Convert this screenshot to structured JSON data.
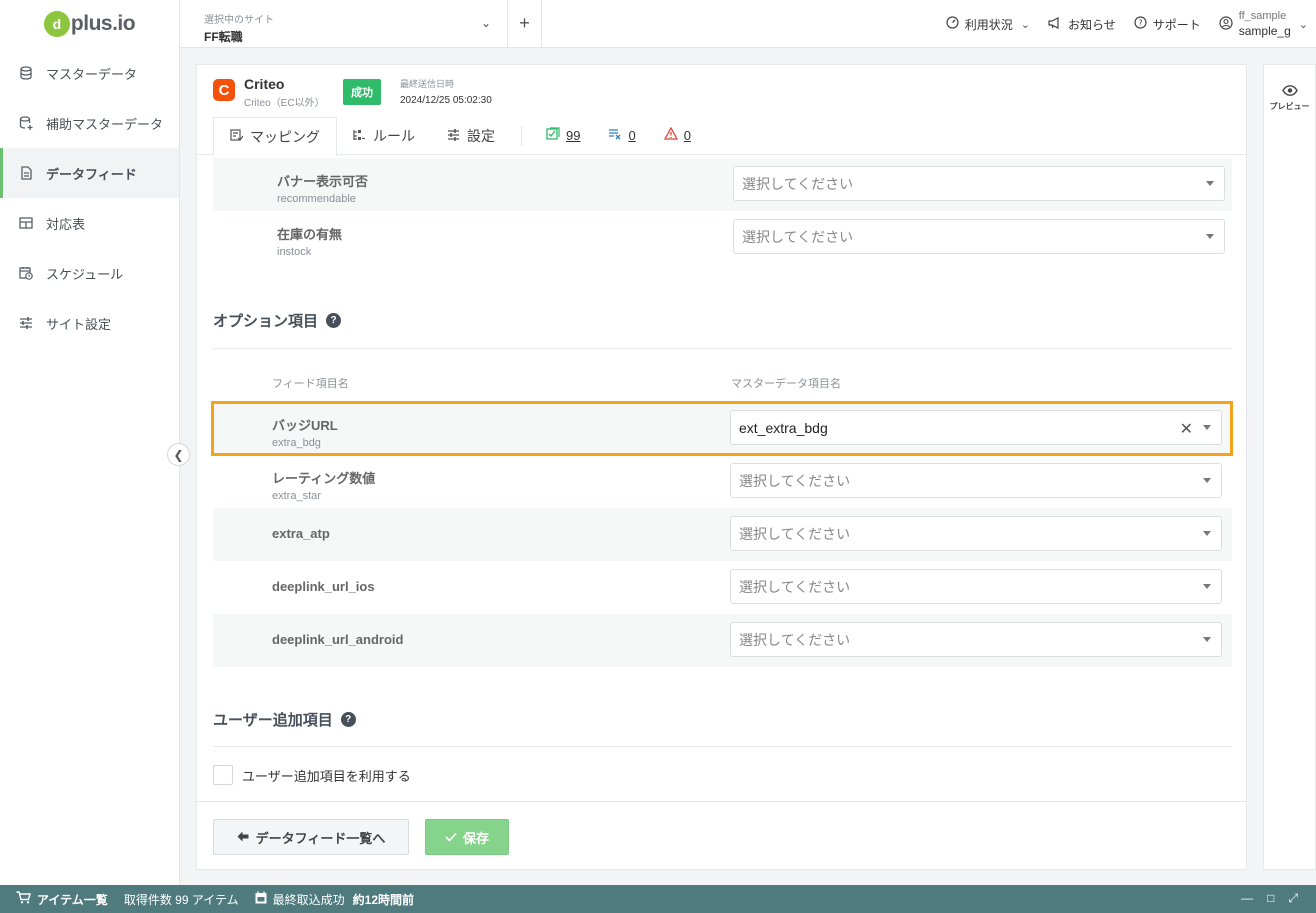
{
  "app": {
    "logo_text": "plus.io",
    "logo_mark": "d"
  },
  "sidebar": {
    "items": [
      {
        "label": "マスターデータ",
        "icon": "database-icon"
      },
      {
        "label": "補助マスターデータ",
        "icon": "database-plus-icon"
      },
      {
        "label": "データフィード",
        "icon": "document-icon",
        "active": true
      },
      {
        "label": "対応表",
        "icon": "table-icon"
      },
      {
        "label": "スケジュール",
        "icon": "calendar-clock-icon"
      },
      {
        "label": "サイト設定",
        "icon": "sliders-icon"
      }
    ]
  },
  "header": {
    "site_label": "選択中のサイト",
    "site_value": "FF転職",
    "usage": "利用状況",
    "news": "お知らせ",
    "support": "サポート",
    "user_id": "ff_sample",
    "user_name": "sample_g"
  },
  "feed": {
    "name": "Criteo",
    "sub": "Criteo（EC以外）",
    "status": "成功",
    "last_sent_label": "最終送信日時",
    "last_sent_value": "2024/12/25 05:02:30"
  },
  "tabs": [
    {
      "label": "マッピング",
      "active": true
    },
    {
      "label": "ルール"
    },
    {
      "label": "設定"
    }
  ],
  "stats": {
    "ok": "99",
    "excluded": "0",
    "warning": "0"
  },
  "required_rows": [
    {
      "ja": "バナー表示可否",
      "en": "recommendable",
      "value": "選択してください"
    },
    {
      "ja": "在庫の有無",
      "en": "instock",
      "value": "選択してください"
    }
  ],
  "option_section": {
    "title": "オプション項目",
    "col_feed": "フィード項目名",
    "col_master": "マスターデータ項目名",
    "rows": [
      {
        "ja": "バッジURL",
        "en": "extra_bdg",
        "value": "ext_extra_bdg"
      },
      {
        "ja": "レーティング数値",
        "en": "extra_star",
        "value": "選択してください"
      },
      {
        "ja": "extra_atp",
        "en": "",
        "value": "選択してください"
      },
      {
        "ja": "deeplink_url_ios",
        "en": "",
        "value": "選択してください"
      },
      {
        "ja": "deeplink_url_android",
        "en": "",
        "value": "選択してください"
      }
    ]
  },
  "user_section": {
    "title": "ユーザー追加項目",
    "checkbox_label": "ユーザー追加項目を利用する"
  },
  "footer": {
    "back": "データフィード一覧へ",
    "save": "保存"
  },
  "preview": {
    "label": "プレビュー"
  },
  "bottom_bar": {
    "items_label": "アイテム一覧",
    "count_text": "取得件数 99 アイテム",
    "last_import_label": "最終取込成功",
    "last_import_value": "約12時間前"
  },
  "colors": {
    "accent_green": "#6bc06f",
    "success_badge": "#2fbb6a",
    "highlight": "#f5a31a",
    "bottom_bar": "#4f7a7e",
    "criteo": "#f4510a"
  }
}
